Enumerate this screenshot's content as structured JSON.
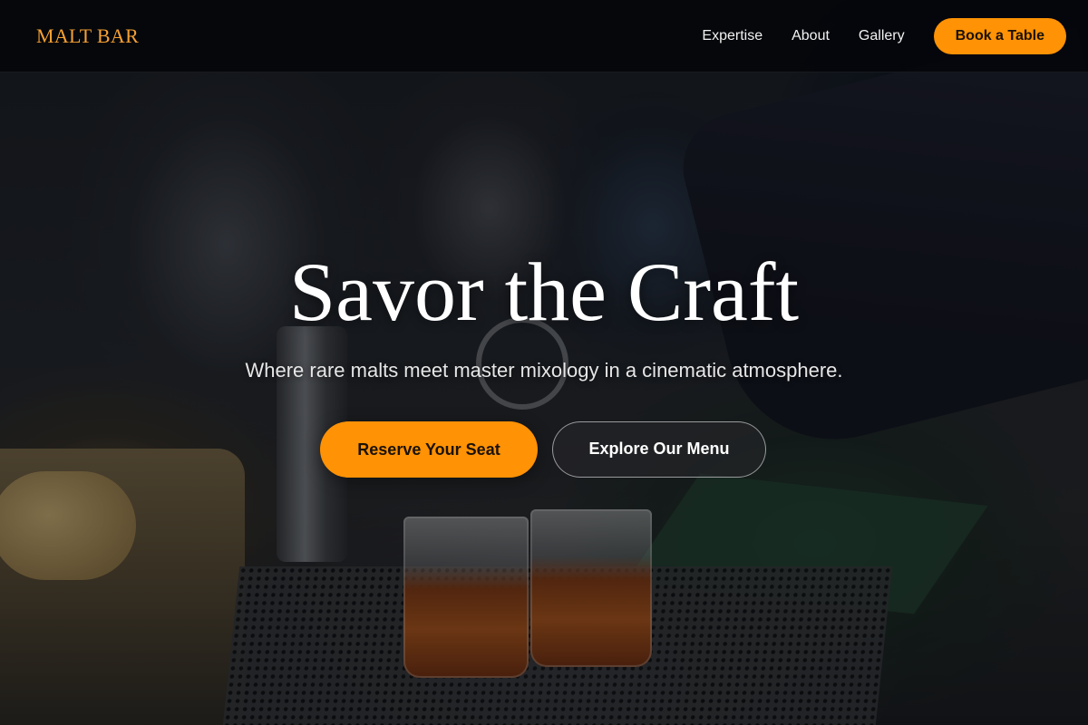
{
  "brand": {
    "logo_text": "MALT BAR",
    "accent_color": "#ff9205"
  },
  "nav": {
    "links": [
      {
        "label": "Expertise"
      },
      {
        "label": "About"
      },
      {
        "label": "Gallery"
      }
    ],
    "cta_label": "Book a Table"
  },
  "hero": {
    "title": "Savor the Craft",
    "subtitle": "Where rare malts meet master mixology in a cinematic atmosphere.",
    "primary_cta": "Reserve Your Seat",
    "secondary_cta": "Explore Our Menu",
    "background_image": "bartender-pouring-cocktails-photo"
  }
}
